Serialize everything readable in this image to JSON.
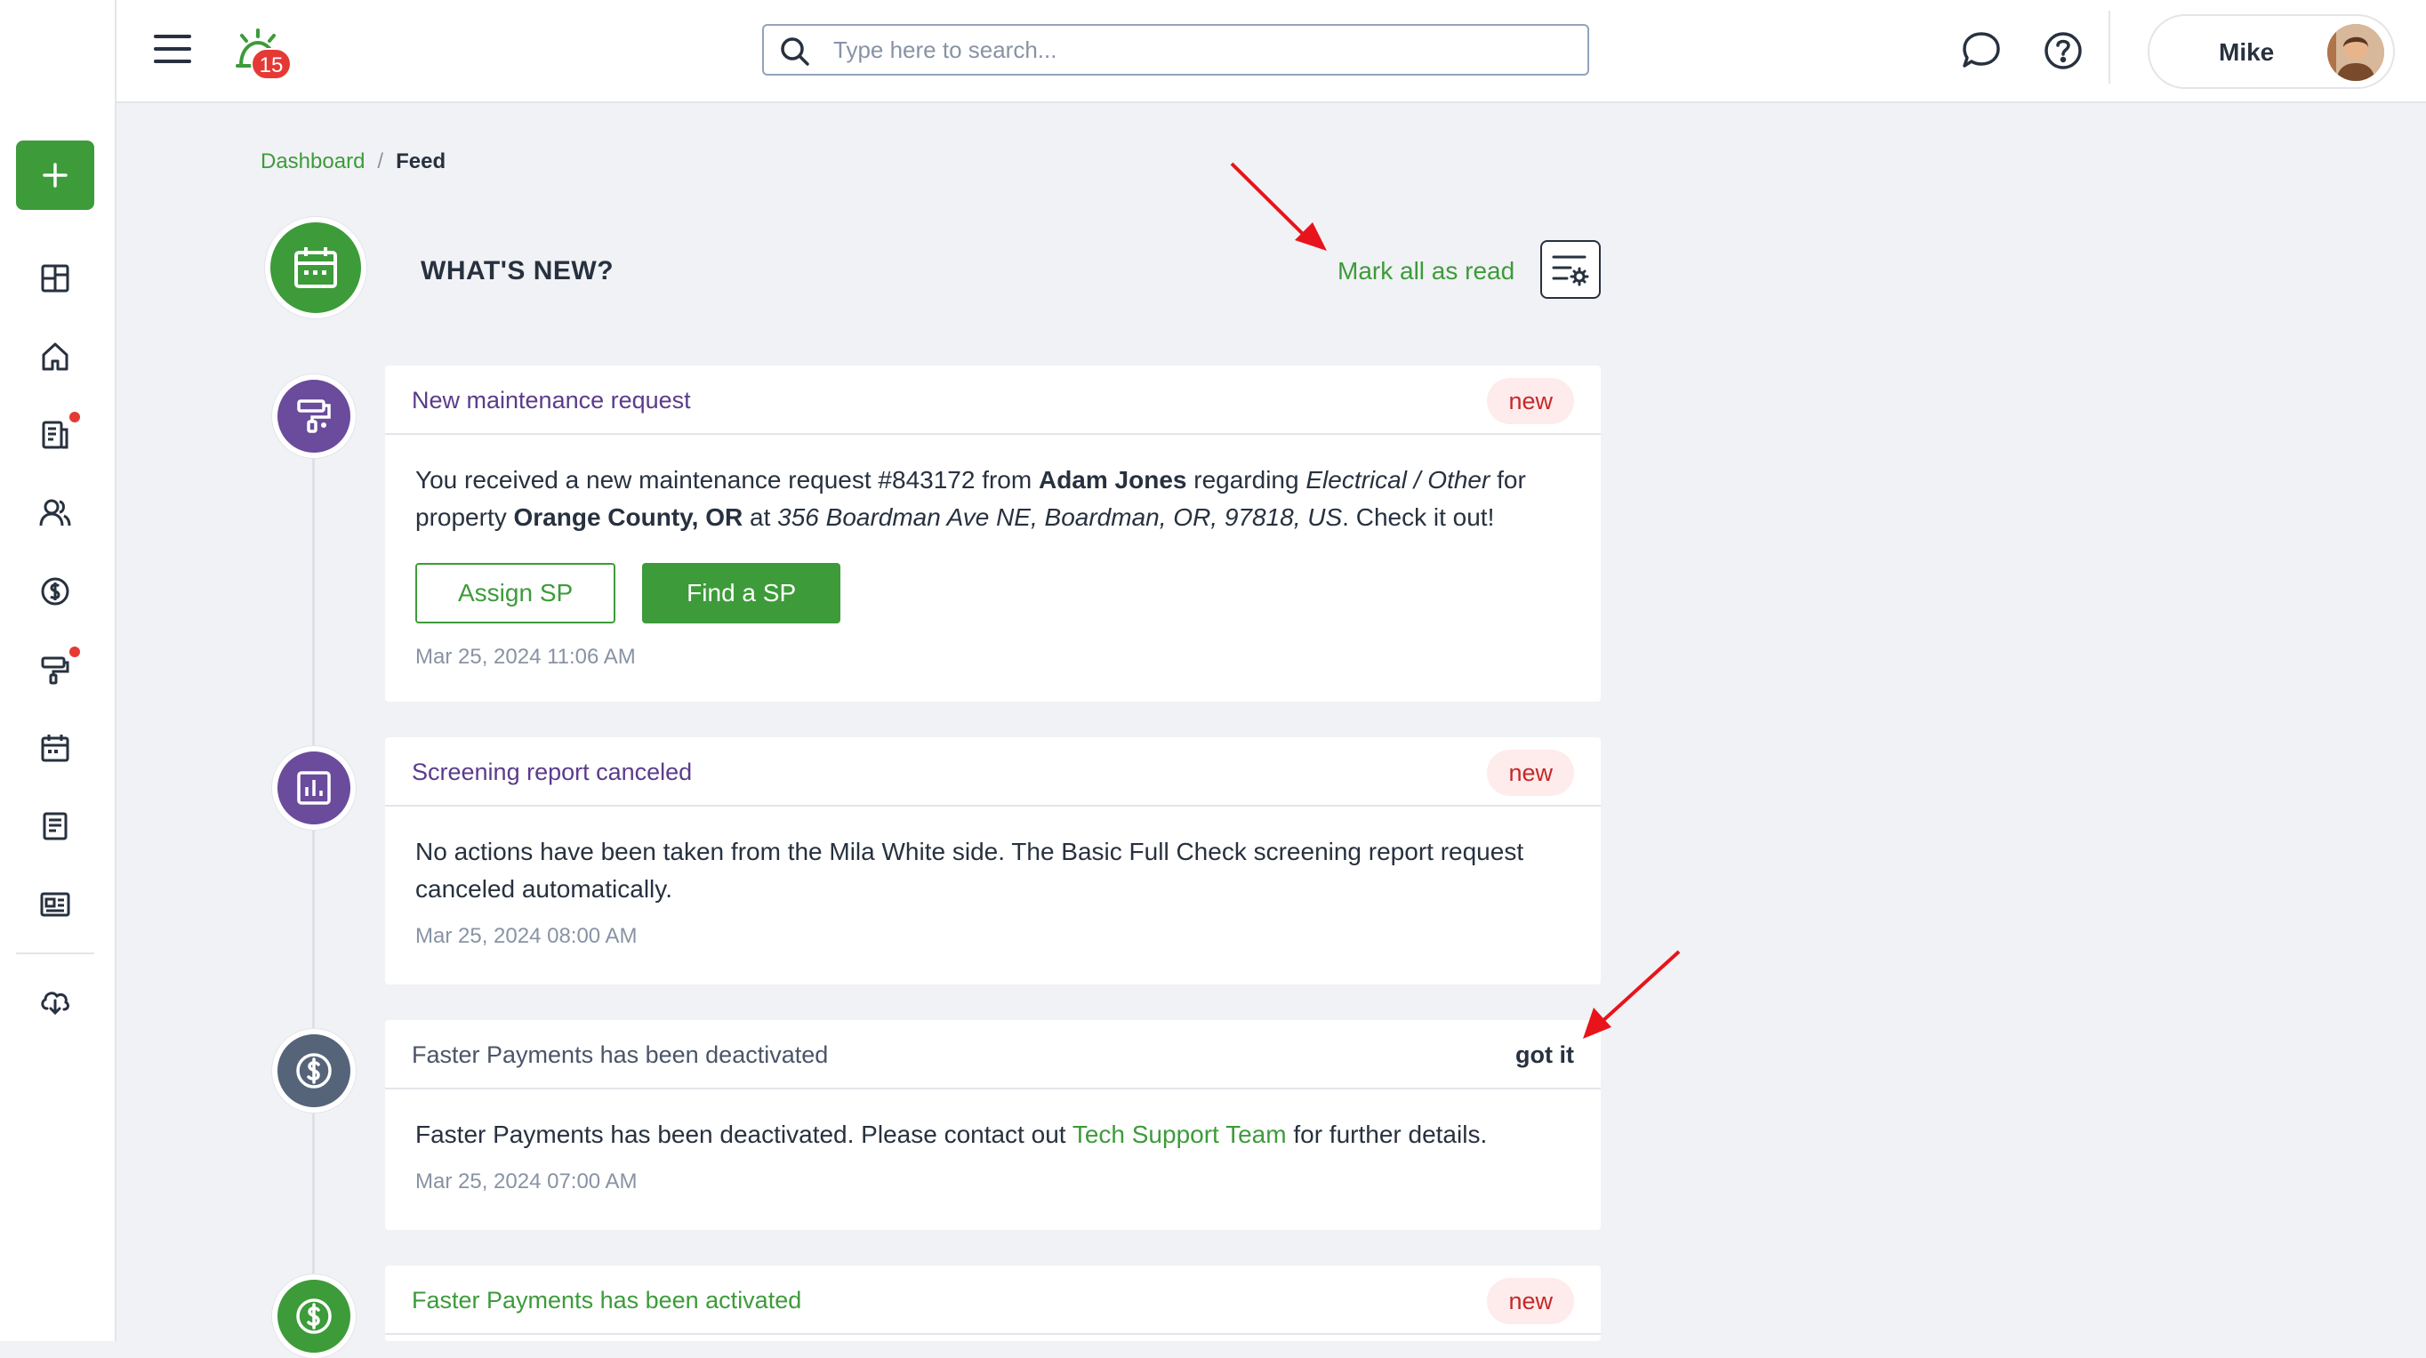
{
  "app": {
    "notification_count": "15"
  },
  "search": {
    "placeholder": "Type here to search..."
  },
  "user": {
    "name": "Mike"
  },
  "breadcrumb": {
    "items": [
      "Dashboard",
      "Feed"
    ],
    "separator": "/"
  },
  "page": {
    "title": "WHAT'S NEW?",
    "mark_all_read": "Mark all as read"
  },
  "feed": [
    {
      "title": "New maintenance request",
      "title_color": "#5b3b8c",
      "icon": "paint-roller-icon",
      "icon_bg": "#6a4b9c",
      "status": "new",
      "text": {
        "p1": "You received a new maintenance request #843172 from ",
        "name": "Adam Jones",
        "p2": " regarding ",
        "category": "Electrical / Other",
        "p3": " for property ",
        "property": "Orange County, OR",
        "p4": " at ",
        "address": "356 Boardman Ave NE, Boardman, OR, 97818, US",
        "p5": ". Check it out!"
      },
      "actions": [
        "Assign SP",
        "Find a SP"
      ],
      "date": "Mar 25, 2024 11:06 AM"
    },
    {
      "title": "Screening report canceled",
      "title_color": "#5b3b8c",
      "icon": "report-chart-icon",
      "icon_bg": "#6a4b9c",
      "status": "new",
      "text": "No actions have been taken from the Mila White side. The Basic Full Check screening report request canceled automatically.",
      "date": "Mar 25, 2024 08:00 AM"
    },
    {
      "title": "Faster Payments has been deactivated",
      "title_color": "#4a5568",
      "icon": "dollar-circle-icon",
      "icon_bg": "#566479",
      "status": "got it",
      "text": {
        "p1": "Faster Payments has been deactivated. Please contact out ",
        "link": "Tech Support Team",
        "p2": " for further details."
      },
      "date": "Mar 25, 2024 07:00 AM"
    },
    {
      "title": "Faster Payments has been activated",
      "title_color": "#3d9b3a",
      "icon": "dollar-circle-icon",
      "icon_bg": "#3d9b3a",
      "status": "new"
    }
  ],
  "colors": {
    "accent": "#3d9b3a",
    "badge_red": "#e53935",
    "new_badge_bg": "#fdeceb",
    "new_badge_text": "#c62828",
    "annotation_arrow": "#e8141b"
  },
  "sidebar": {
    "icons": [
      "plus-icon",
      "dashboard-icon",
      "home-icon",
      "leases-icon",
      "people-icon",
      "dollar-icon",
      "maintenance-icon",
      "calendar-icon",
      "document-icon",
      "listing-icon",
      "download-cloud-icon"
    ]
  }
}
